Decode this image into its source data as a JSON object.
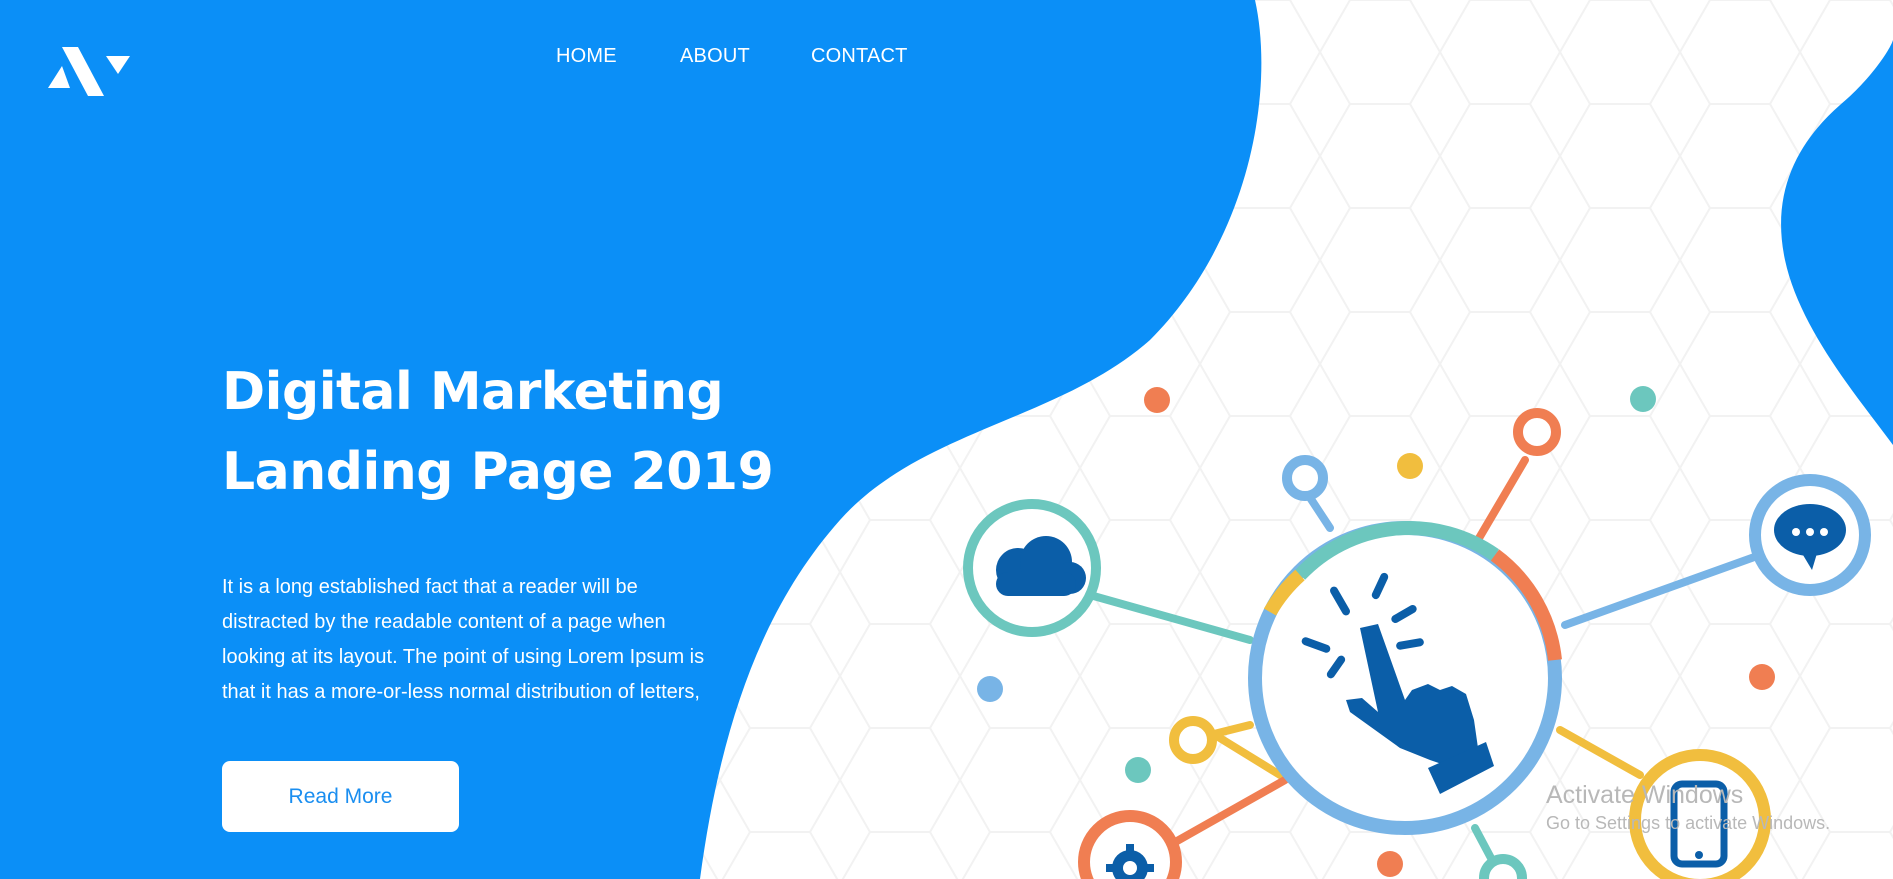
{
  "colors": {
    "brand_blue": "#0b8ff7",
    "accent_teal": "#6cc7be",
    "accent_orange": "#f07e52",
    "accent_yellow": "#f1be3e",
    "accent_lightblue": "#78b4e6",
    "icon_darkblue": "#0b5ea8"
  },
  "logo": {
    "icon": "brand-logo-icon"
  },
  "nav": {
    "items": [
      {
        "label": "HOME"
      },
      {
        "label": "ABOUT"
      },
      {
        "label": "CONTACT"
      }
    ]
  },
  "hero": {
    "title_lines": [
      "Digital Marketing",
      "Landing Page 2019"
    ],
    "description_lines": [
      "It is a long established fact that a reader will be",
      "distracted by the readable content of a page when",
      "looking at its layout. The point of using Lorem Ipsum is",
      "that it has a more-or-less normal distribution of letters,"
    ],
    "button_label": "Read More"
  },
  "illustration": {
    "icons": [
      "cloud-icon",
      "pointer-hand-icon",
      "chat-bubble-icon",
      "smartphone-icon",
      "gear-icon"
    ]
  },
  "watermark": {
    "title": "Activate Windows",
    "subtitle": "Go to Settings to activate Windows."
  }
}
